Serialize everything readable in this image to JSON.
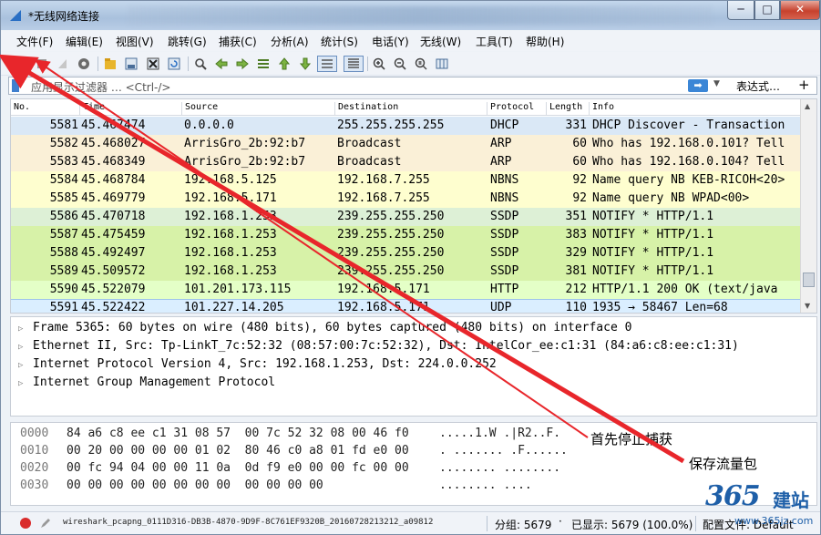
{
  "window": {
    "title": "*无线网络连接",
    "min": "─",
    "max": "□",
    "close": "✕"
  },
  "menu": [
    "文件(F)",
    "编辑(E)",
    "视图(V)",
    "跳转(G)",
    "捕获(C)",
    "分析(A)",
    "统计(S)",
    "电话(Y)",
    "无线(W)",
    "工具(T)",
    "帮助(H)"
  ],
  "toolbar_icons": [
    "shark-fin-start-icon",
    "stop-capture-icon",
    "restart-capture-icon",
    "capture-options-icon",
    "open-file-icon",
    "save-file-icon",
    "close-file-icon",
    "reload-icon",
    "find-icon",
    "go-back-icon",
    "go-forward-icon",
    "go-to-packet-icon",
    "first-packet-icon",
    "last-packet-icon",
    "autoscroll-icon",
    "colorize-icon",
    "zoom-in-icon",
    "zoom-out-icon",
    "zoom-normal-icon",
    "resize-columns-icon"
  ],
  "filter": {
    "placeholder": "应用显示过滤器 … <Ctrl-/>",
    "apply": "➡",
    "expression_label": "表达式…",
    "plus": "+"
  },
  "packet_list": {
    "columns": [
      "No.",
      "Time",
      "Source",
      "Destination",
      "Protocol",
      "Length",
      "Info"
    ],
    "rows": [
      {
        "no": "5581",
        "time": "45.467474",
        "src": "0.0.0.0",
        "dst": "255.255.255.255",
        "proto": "DHCP",
        "len": "331",
        "info": "DHCP Discover - Transaction",
        "bg": "#dae8f6"
      },
      {
        "no": "5582",
        "time": "45.468027",
        "src": "ArrisGro_2b:92:b7",
        "dst": "Broadcast",
        "proto": "ARP",
        "len": "60",
        "info": "Who has 192.168.0.101? Tell",
        "bg": "#faf0d7"
      },
      {
        "no": "5583",
        "time": "45.468349",
        "src": "ArrisGro_2b:92:b7",
        "dst": "Broadcast",
        "proto": "ARP",
        "len": "60",
        "info": "Who has 192.168.0.104? Tell",
        "bg": "#faf0d7"
      },
      {
        "no": "5584",
        "time": "45.468784",
        "src": "192.168.5.125",
        "dst": "192.168.7.255",
        "proto": "NBNS",
        "len": "92",
        "info": "Name query NB KEB-RICOH<20>",
        "bg": "#fefecf"
      },
      {
        "no": "5585",
        "time": "45.469779",
        "src": "192.168.5.171",
        "dst": "192.168.7.255",
        "proto": "NBNS",
        "len": "92",
        "info": "Name query NB WPAD<00>",
        "bg": "#fefecf"
      },
      {
        "no": "5586",
        "time": "45.470718",
        "src": "192.168.1.253",
        "dst": "239.255.255.250",
        "proto": "SSDP",
        "len": "351",
        "info": "NOTIFY * HTTP/1.1",
        "bg": "#ddf0d6"
      },
      {
        "no": "5587",
        "time": "45.475459",
        "src": "192.168.1.253",
        "dst": "239.255.255.250",
        "proto": "SSDP",
        "len": "383",
        "info": "NOTIFY * HTTP/1.1",
        "bg": "#d7f2a8"
      },
      {
        "no": "5588",
        "time": "45.492497",
        "src": "192.168.1.253",
        "dst": "239.255.255.250",
        "proto": "SSDP",
        "len": "329",
        "info": "NOTIFY * HTTP/1.1",
        "bg": "#d7f2a8"
      },
      {
        "no": "5589",
        "time": "45.509572",
        "src": "192.168.1.253",
        "dst": "239.255.255.250",
        "proto": "SSDP",
        "len": "381",
        "info": "NOTIFY * HTTP/1.1",
        "bg": "#d7f2a8"
      },
      {
        "no": "5590",
        "time": "45.522079",
        "src": "101.201.173.115",
        "dst": "192.168.5.171",
        "proto": "HTTP",
        "len": "212",
        "info": "HTTP/1.1 200 OK  (text/java",
        "bg": "#e4ffc7"
      },
      {
        "no": "5591",
        "time": "45.522422",
        "src": "101.227.14.205",
        "dst": "192.168.5.171",
        "proto": "UDP",
        "len": "110",
        "info": "1935 → 58467  Len=68",
        "bg": "#daeeff"
      }
    ]
  },
  "details": [
    "Frame 5365: 60 bytes on wire (480 bits), 60 bytes captured (480 bits) on interface 0",
    "Ethernet II, Src: Tp-LinkT_7c:52:32 (08:57:00:7c:52:32), Dst: IntelCor_ee:c1:31 (84:a6:c8:ee:c1:31)",
    "Internet Protocol Version 4, Src: 192.168.1.253, Dst: 224.0.0.252",
    "Internet Group Management Protocol"
  ],
  "bytes": [
    {
      "off": "0000",
      "hex": "84 a6 c8 ee c1 31 08 57  00 7c 52 32 08 00 46 f0",
      "ascii": ".....1.W .|R2..F."
    },
    {
      "off": "0010",
      "hex": "00 20 00 00 00 00 01 02  80 46 c0 a8 01 fd e0 00",
      "ascii": ". ....... .F......"
    },
    {
      "off": "0020",
      "hex": "00 fc 94 04 00 00 11 0a  0d f9 e0 00 00 fc 00 00",
      "ascii": "........ ........"
    },
    {
      "off": "0030",
      "hex": "00 00 00 00 00 00 00 00  00 00 00 00",
      "ascii": "........ ...."
    }
  ],
  "annotations": {
    "stop_capture": "首先停止捕获",
    "save_packets": "保存流量包"
  },
  "status": {
    "file": "wireshark_pcapng_0111D316-DB3B-4870-9D9F-8C761EF9320B_20160728213212_a09812",
    "packets": "分组: 5679",
    "displayed": "已显示: 5679 (100.0%)",
    "profile": "配置文件: Default"
  },
  "watermark": {
    "number": "365",
    "name": "建站",
    "url": "www.365jz.com"
  },
  "colors": {
    "arrow": "#e8262b",
    "status_dot": "#d92b2b",
    "apply_button": "#3b86d6"
  }
}
